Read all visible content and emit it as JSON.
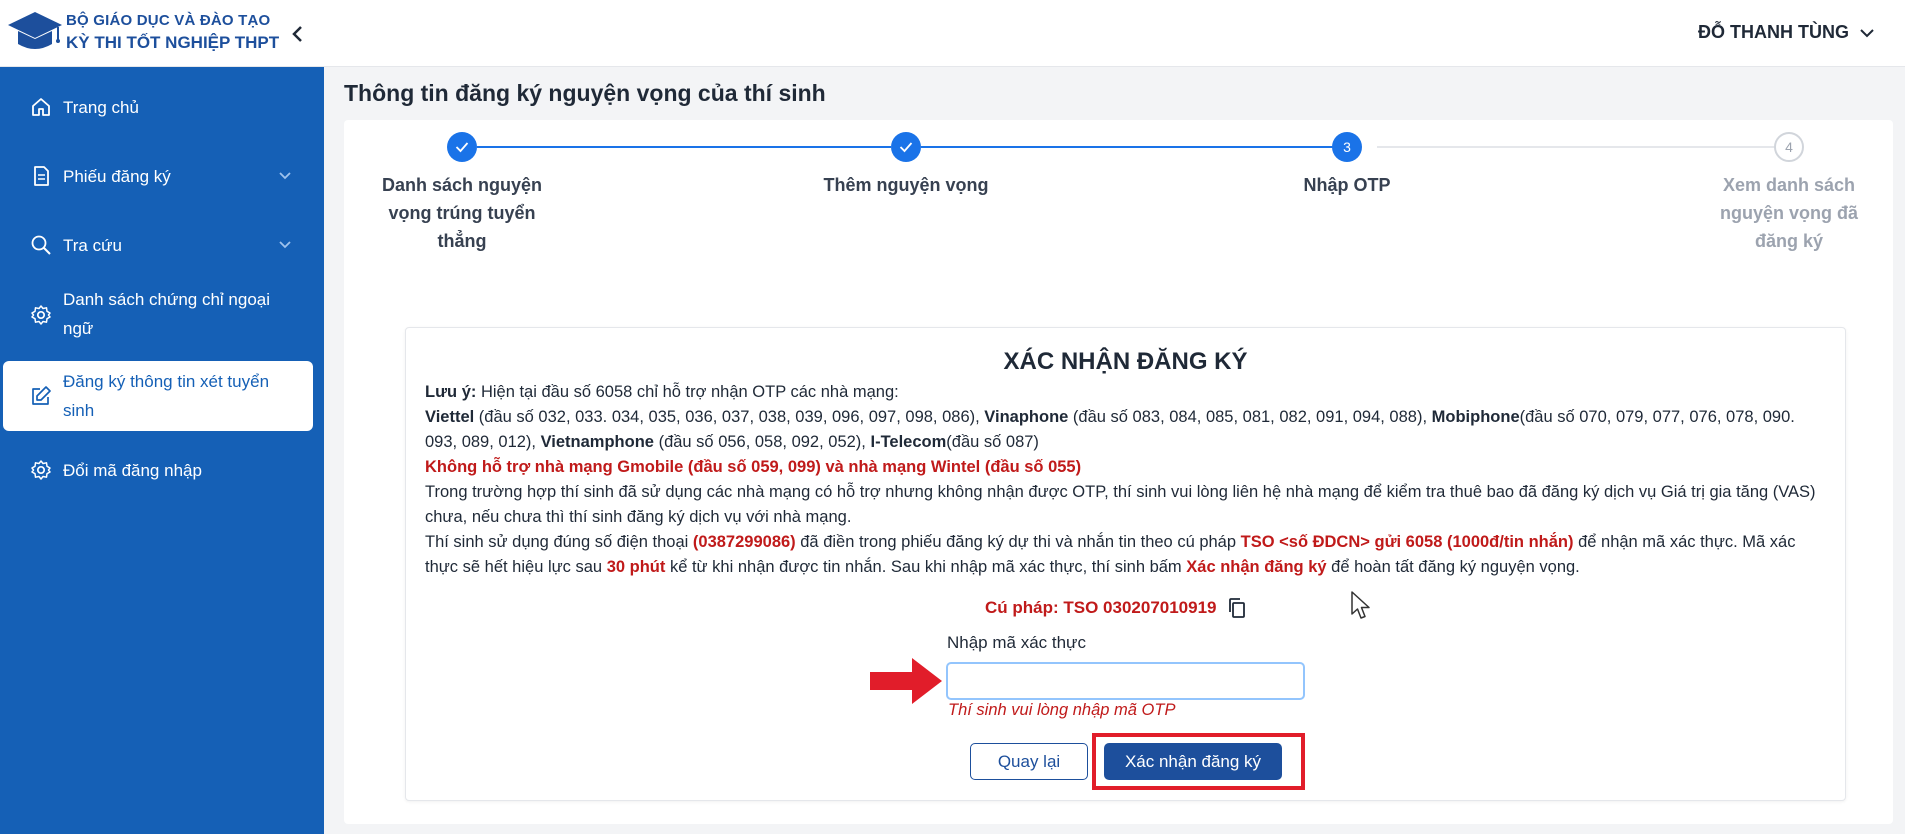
{
  "header": {
    "org_line": "BỘ GIÁO DỤC VÀ ĐÀO TẠO",
    "title_line": "KỲ THI TỐT NGHIỆP THPT",
    "user_name": "ĐỖ THANH TÙNG"
  },
  "sidebar": {
    "items": [
      {
        "label": "Trang chủ",
        "icon": "home-icon"
      },
      {
        "label": "Phiếu đăng ký",
        "icon": "document-icon"
      },
      {
        "label": "Tra cứu",
        "icon": "search-icon"
      },
      {
        "label_line1": "Danh sách chứng chỉ ngoại",
        "label_line2": "ngữ",
        "icon": "gear-icon"
      },
      {
        "label_line1": "Đăng ký thông tin xét tuyển",
        "label_line2": "sinh",
        "icon": "edit-icon",
        "active": true
      },
      {
        "label": "Đổi mã đăng nhập",
        "icon": "gear-icon"
      }
    ]
  },
  "main": {
    "page_title": "Thông tin đăng ký nguyện vọng của thí sinh",
    "steps": [
      {
        "number": "1",
        "line1": "Danh sách nguyện",
        "line2": "vọng trúng tuyển",
        "line3": "thẳng",
        "status": "done"
      },
      {
        "number": "2",
        "line1": "Thêm nguyện vọng",
        "status": "done"
      },
      {
        "number": "3",
        "line1": "Nhập OTP",
        "status": "current"
      },
      {
        "number": "4",
        "line1": "Xem danh sách",
        "line2": "nguyện vọng đã",
        "line3": "đăng ký",
        "status": "pending"
      }
    ]
  },
  "confirm": {
    "title": "XÁC NHẬN ĐĂNG KÝ",
    "note_label": "Lưu ý:",
    "note_text": " Hiện tại đầu số 6058 chỉ hỗ trợ nhận OTP các nhà mạng:",
    "viettel": "Viettel",
    "viettel_nums": " (đầu số 032, 033. 034, 035, 036, 037, 038, 039, 096, 097, 098, 086), ",
    "vinaphone": "Vinaphone",
    "vinaphone_nums": " (đầu số 083, 084, 085, 081, 082, 091, 094, 088), ",
    "mobiphone": "Mobiphone",
    "mobiphone_nums": "(đầu số 070, 079, 077, 076, 078, 090. 093, 089, 012), ",
    "vietnamphone": "Vietnamphone",
    "vietnamphone_nums": " (đầu số 056, 058, 092, 052), ",
    "itelecom": "I-Telecom",
    "itelecom_nums": "(đầu số 087)",
    "unsupported": "Không hỗ trợ nhà mạng Gmobile (đầu số 059, 099) và nhà mạng Wintel (đầu số 055)",
    "vas_text": "Trong trường hợp thí sinh đã sử dụng các nhà mạng có hỗ trợ nhưng không nhận được OTP, thí sinh vui lòng liên hệ nhà mạng để kiểm tra thuê bao đã đăng ký dịch vụ Giá trị gia tăng (VAS) chưa, nếu chưa thì thí sinh đăng ký dịch vụ với nhà mạng.",
    "instr_1": "Thí sinh sử dụng đúng số điện thoại ",
    "phone": "(0387299086)",
    "instr_2": " đã điền trong phiếu đăng ký dự thi và nhắn tin theo cú pháp ",
    "syntax_template": "TSO <số ĐDCN> gửi 6058 (1000đ/tin nhắn)",
    "instr_3": " để nhận mã xác thực. Mã xác thực sẽ hết hiệu lực sau ",
    "expiry": "30 phút",
    "instr_4": " kể từ khi nhận được tin nhắn. Sau khi nhập mã xác thực, thí sinh bấm ",
    "confirm_phrase": "Xác nhận đăng ký",
    "instr_5": " để hoàn tất đăng ký nguyện vọng.",
    "syntax_line": "Cú pháp: TSO 030207010919",
    "otp_label": "Nhập mã xác thực",
    "otp_value": "",
    "otp_error": "Thí sinh vui lòng nhập mã OTP",
    "back_button": "Quay lại",
    "confirm_button": "Xác nhận đăng ký"
  },
  "colors": {
    "sidebar": "#1560b6",
    "brand": "#1d4f9c",
    "step_active": "#1a73e8",
    "error": "#c01a1a",
    "highlight": "#e11d2a"
  }
}
